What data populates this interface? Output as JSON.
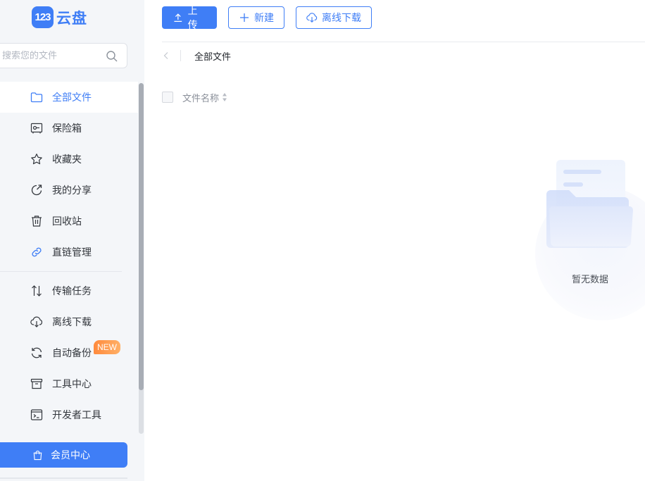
{
  "brand": {
    "badge": "123",
    "name": "云盘",
    "accent": "#3f7ef6"
  },
  "search": {
    "placeholder": "搜索您的文件",
    "icon": "search-icon"
  },
  "sidebar": {
    "group1": [
      {
        "label": "全部文件",
        "icon": "folder-icon",
        "active": true
      },
      {
        "label": "保险箱",
        "icon": "safe-icon"
      },
      {
        "label": "收藏夹",
        "icon": "star-icon"
      },
      {
        "label": "我的分享",
        "icon": "share-icon"
      },
      {
        "label": "回收站",
        "icon": "trash-icon"
      },
      {
        "label": "直链管理",
        "icon": "link-icon"
      }
    ],
    "group2": [
      {
        "label": "传输任务",
        "icon": "transfer-icon"
      },
      {
        "label": "离线下载",
        "icon": "cloud-download-icon"
      },
      {
        "label": "自动备份",
        "icon": "sync-icon",
        "badge": "NEW"
      },
      {
        "label": "工具中心",
        "icon": "toolbox-icon"
      },
      {
        "label": "开发者工具",
        "icon": "terminal-icon"
      }
    ],
    "vip_label": "会员中心"
  },
  "toolbar": {
    "upload_label": "上传",
    "new_label": "新建",
    "offline_label": "离线下载"
  },
  "breadcrumb": {
    "current": "全部文件"
  },
  "table": {
    "header_name": "文件名称"
  },
  "empty": {
    "text": "暂无数据"
  }
}
